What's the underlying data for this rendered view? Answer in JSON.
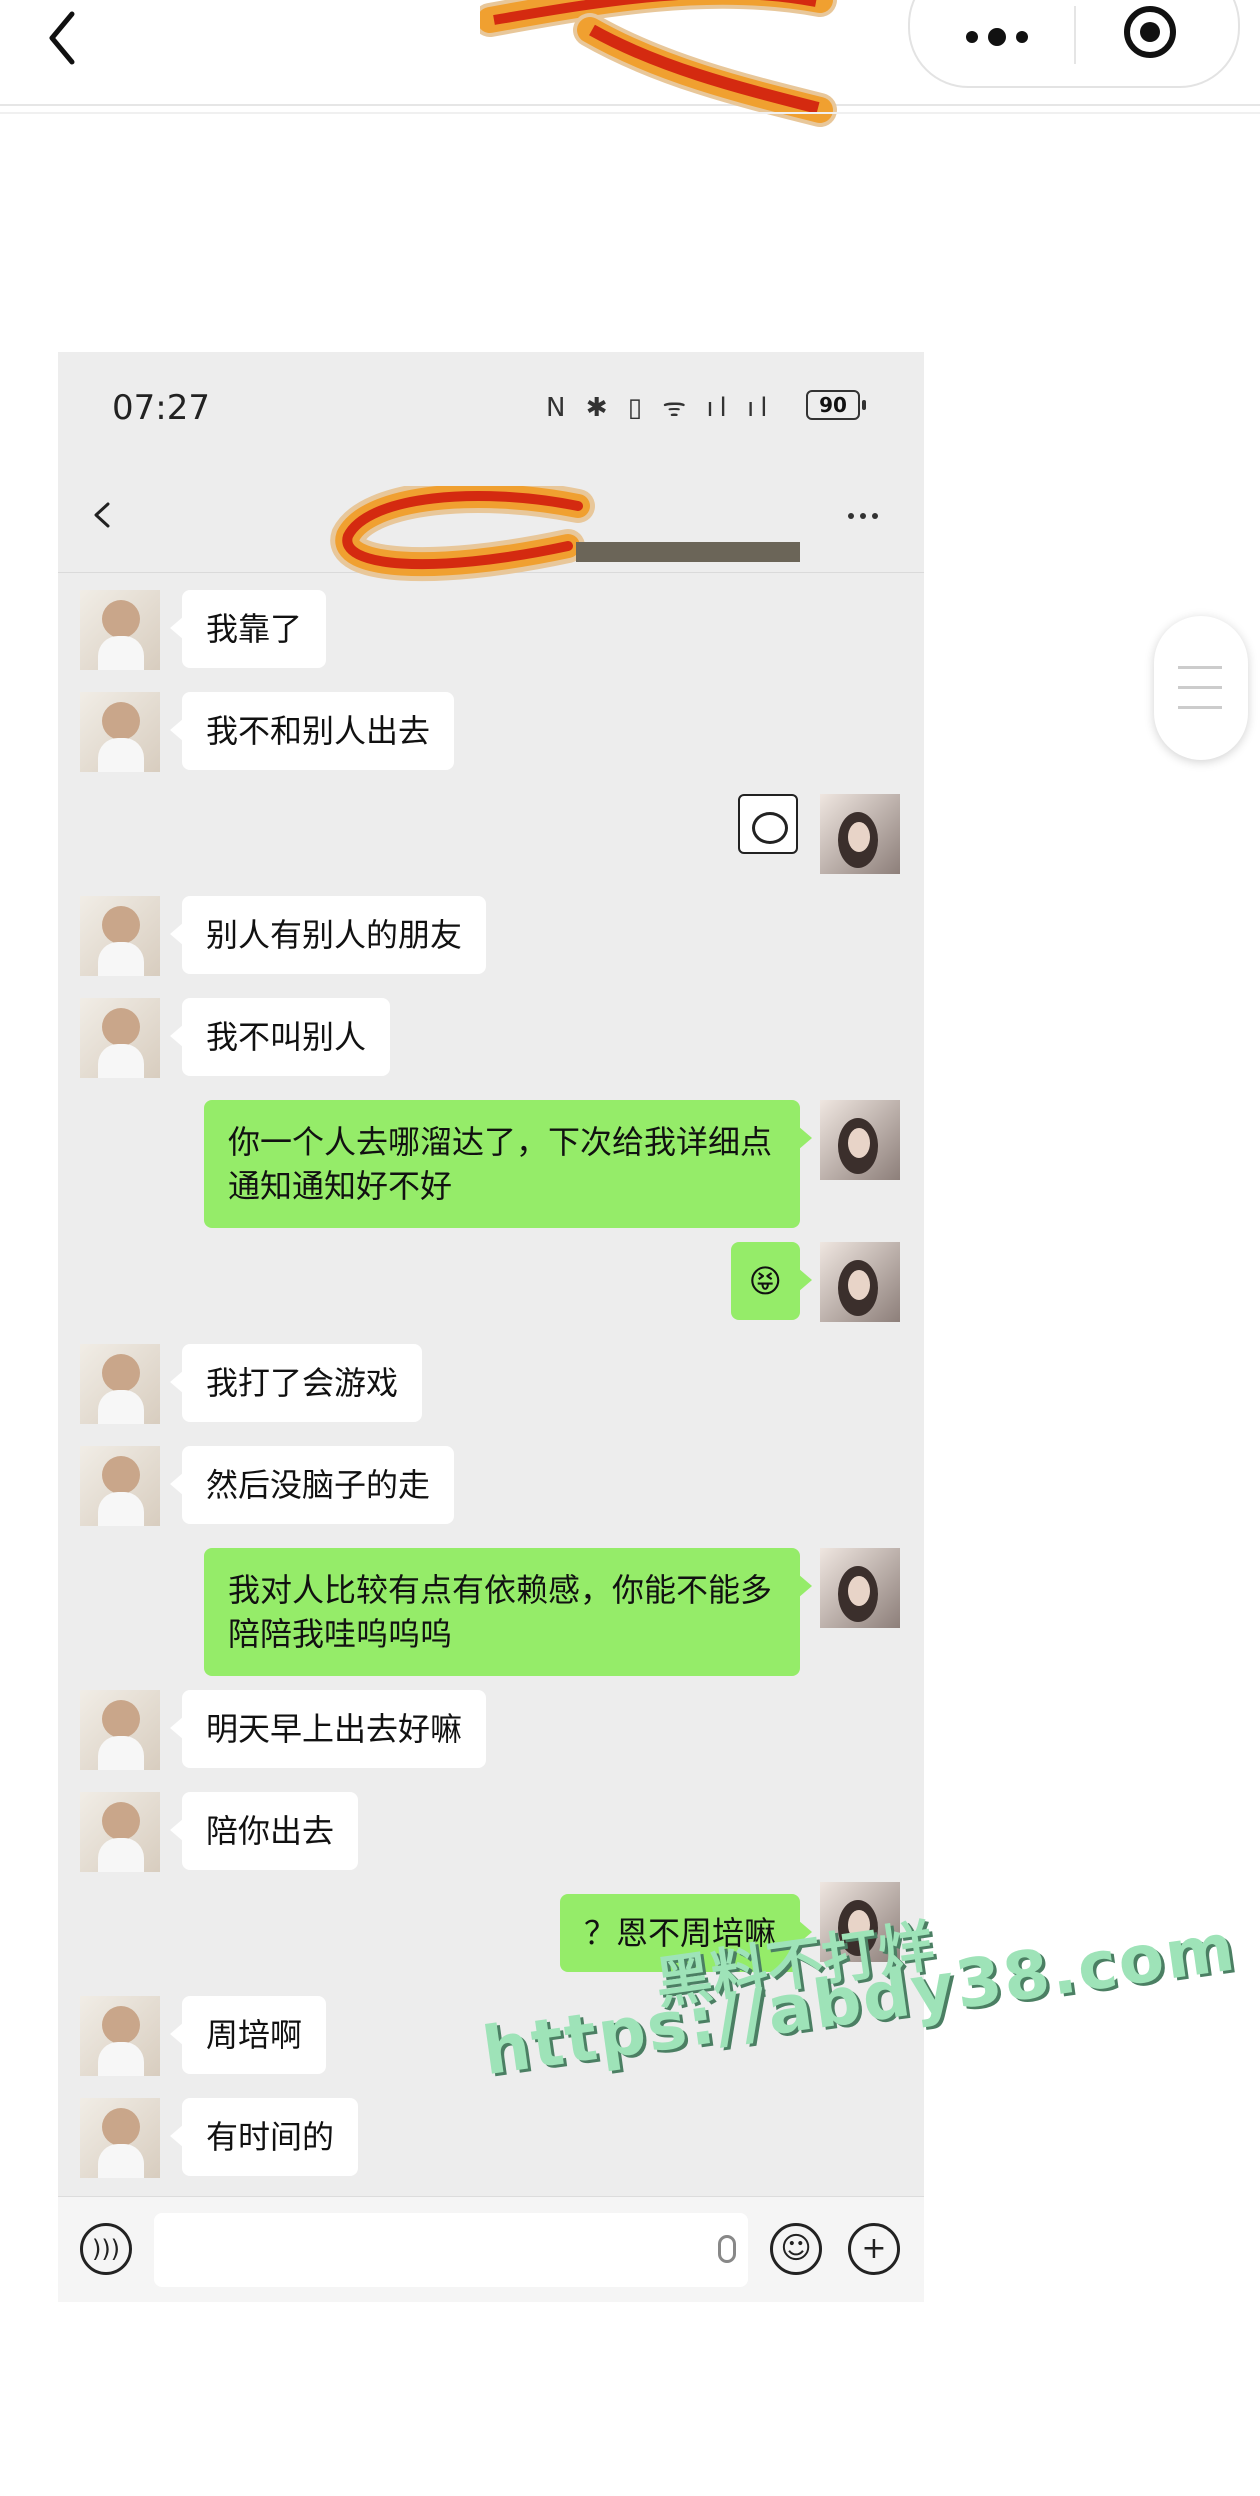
{
  "top_bar": {
    "back_icon": "chevron-left-icon",
    "menu_icon": "more-dots-icon",
    "close_icon": "target-circle-icon"
  },
  "screenshot": {
    "status_bar": {
      "time": "07:27",
      "icons": "N ✱ ▯ ᯤ ıl ıl",
      "battery": "90"
    },
    "nav": {
      "back_icon": "chevron-left-icon",
      "more_icon": "more-dots-icon"
    },
    "messages": [
      {
        "side": "left",
        "text": "我靠了"
      },
      {
        "side": "left",
        "text": "我不和别人出去"
      },
      {
        "side": "right",
        "sticker": true
      },
      {
        "side": "left",
        "text": "别人有别人的朋友"
      },
      {
        "side": "left",
        "text": "我不叫别人"
      },
      {
        "side": "right",
        "text": "你一个人去哪溜达了，下次给我详细点通知通知好不好"
      },
      {
        "side": "right",
        "text": "😝"
      },
      {
        "side": "left",
        "text": "我打了会游戏"
      },
      {
        "side": "left",
        "text": "然后没脑子的走"
      },
      {
        "side": "right",
        "text": "我对人比较有点有依赖感，你能不能多陪陪我哇呜呜呜"
      },
      {
        "side": "left",
        "text": "明天早上出去好嘛"
      },
      {
        "side": "left",
        "text": "陪你出去"
      },
      {
        "side": "right",
        "text": "？恩不周培嘛"
      },
      {
        "side": "left",
        "text": "周培啊"
      },
      {
        "side": "left",
        "text": "有时间的"
      }
    ],
    "input_bar": {
      "voice_icon": "voice-icon",
      "mic_icon": "mic-icon",
      "emoji_icon": "emoji-icon",
      "plus_icon": "plus-icon"
    }
  },
  "watermark": {
    "line1": "黑料不打烊",
    "line2": "https://abdy38.com"
  }
}
